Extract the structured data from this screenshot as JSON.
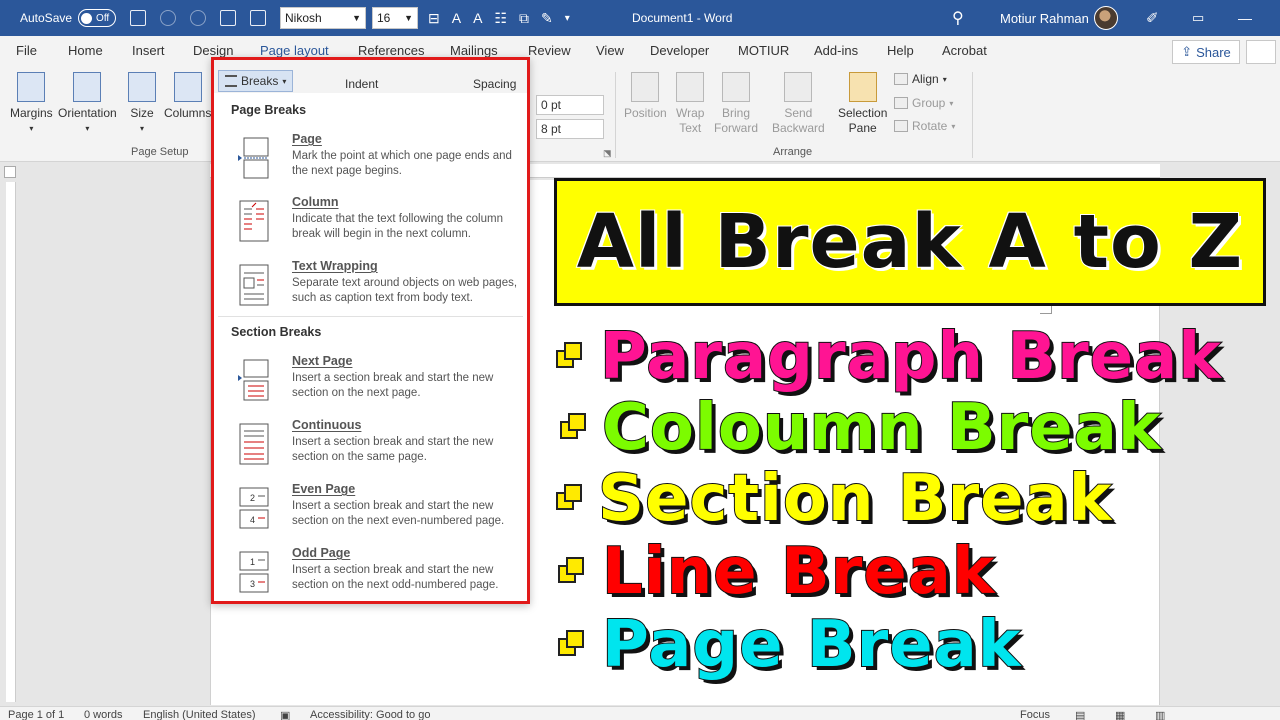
{
  "titlebar": {
    "autosave_label": "AutoSave",
    "autosave_state": "Off",
    "font_name": "Nikosh",
    "font_size": "16",
    "doc_title": "Document1 - Word",
    "user_name": "Motiur Rahman"
  },
  "tabs": [
    "File",
    "Home",
    "Insert",
    "Design",
    "Page layout",
    "References",
    "Mailings",
    "Review",
    "View",
    "Developer",
    "MOTIUR",
    "Add-ins",
    "Help",
    "Acrobat"
  ],
  "active_tab": "Page layout",
  "share_label": "Share",
  "ribbon": {
    "page_setup": {
      "margins": "Margins",
      "orientation": "Orientation",
      "size": "Size",
      "columns": "Columns",
      "label": "Page Setup"
    },
    "spacing_before": "0 pt",
    "spacing_after": "8 pt",
    "arrange": {
      "position": "Position",
      "wrap_text_1": "Wrap",
      "wrap_text_2": "Text",
      "bring_forward_1": "Bring",
      "bring_forward_2": "Forward",
      "send_backward_1": "Send",
      "send_backward_2": "Backward",
      "selection_pane_1": "Selection",
      "selection_pane_2": "Pane",
      "align": "Align",
      "group": "Group",
      "rotate": "Rotate",
      "label": "Arrange"
    }
  },
  "breaks_menu": {
    "button_label": "Breaks",
    "indent_label": "Indent",
    "spacing_label": "Spacing",
    "page_breaks_title": "Page Breaks",
    "section_breaks_title": "Section Breaks",
    "page_items": [
      {
        "title": "Page",
        "desc": "Mark the point at which one page ends and the next page begins."
      },
      {
        "title": "Column",
        "desc": "Indicate that the text following the column break will begin in the next column."
      },
      {
        "title": "Text Wrapping",
        "desc": "Separate text around objects on web pages, such as caption text from body text."
      }
    ],
    "section_items": [
      {
        "title": "Next Page",
        "desc": "Insert a section break and start the new section on the next page."
      },
      {
        "title": "Continuous",
        "desc": "Insert a section break and start the new section on the same page."
      },
      {
        "title": "Even Page",
        "desc": "Insert a section break and start the new section on the next even-numbered page."
      },
      {
        "title": "Odd Page",
        "desc": "Insert a section break and start the new section on the next odd-numbered page."
      }
    ]
  },
  "promo": {
    "title": "All Break A to Z",
    "items": [
      {
        "text": "Paragraph Break",
        "color": "#ff1493"
      },
      {
        "text": "Coloumn Break",
        "color": "#7cfc00"
      },
      {
        "text": "Section Break",
        "color": "#ffff00"
      },
      {
        "text": "Line Break",
        "color": "#ff0000"
      },
      {
        "text": "Page Break",
        "color": "#00e5ee"
      }
    ]
  },
  "statusbar": {
    "page": "Page 1 of 1",
    "words": "0 words",
    "language": "English (United States)",
    "accessibility": "Accessibility: Good to go",
    "focus": "Focus"
  }
}
